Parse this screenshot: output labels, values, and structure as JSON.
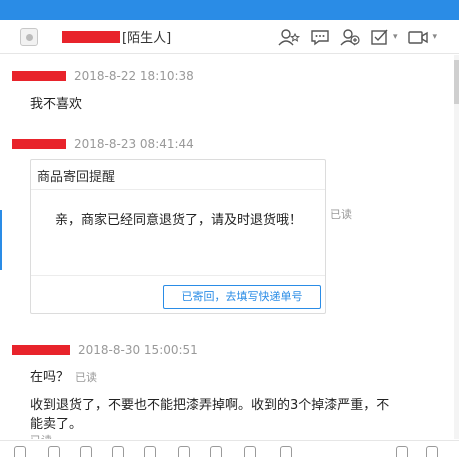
{
  "header": {
    "tag": "[陌生人]",
    "icons": [
      "add-friend-icon",
      "chat-bubble-icon",
      "add-group-icon",
      "task-icon",
      "video-call-icon",
      "dropdown-caret-icon"
    ]
  },
  "messages": [
    {
      "timestamp": "2018-8-22 18:10:38",
      "text": "我不喜欢"
    },
    {
      "timestamp": "2018-8-23 08:41:44",
      "card": {
        "title": "商品寄回提醒",
        "body": "亲，商家已经同意退货了，请及时退货哦！",
        "button": "已寄回，去填写快递单号"
      },
      "read": "已读"
    },
    {
      "timestamp": "2018-8-30 15:00:51",
      "text1": "在吗？",
      "read1": "已读",
      "text2a": "收到退货了，不要也不能把漆弄掉啊。收到的3个掉漆严重，不",
      "text2b": "能卖了。",
      "read2": "已读"
    }
  ],
  "colors": {
    "accent": "#2a8ce6",
    "redaction": "#e8232b"
  }
}
